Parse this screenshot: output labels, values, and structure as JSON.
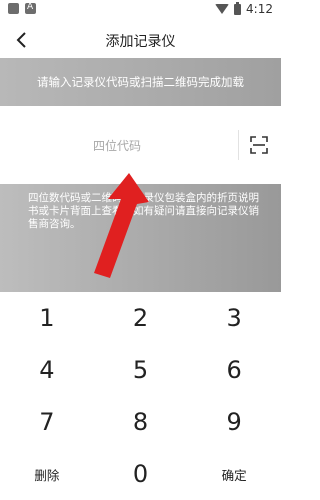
{
  "statusbar": {
    "time": "4:12"
  },
  "appbar": {
    "title": "添加记录仪"
  },
  "banner": {
    "text": "请输入记录仪代码或扫描二维码完成加载"
  },
  "code_input": {
    "placeholder": "四位代码",
    "value": ""
  },
  "info": {
    "text": "四位数代码或二维码在记录仪包装盒内的折页说明书或卡片背面上查看，如有疑问请直接向记录仪销售商咨询。"
  },
  "keypad": {
    "k1": "1",
    "k2": "2",
    "k3": "3",
    "k4": "4",
    "k5": "5",
    "k6": "6",
    "k7": "7",
    "k8": "8",
    "k9": "9",
    "delete": "删除",
    "k0": "0",
    "confirm": "确定"
  },
  "colors": {
    "banner": "#a8a8a8",
    "info_block": "#aaaaaa",
    "annotation_arrow": "#e02020"
  },
  "icons": {
    "back": "back-arrow-icon",
    "scan": "scan-icon"
  }
}
